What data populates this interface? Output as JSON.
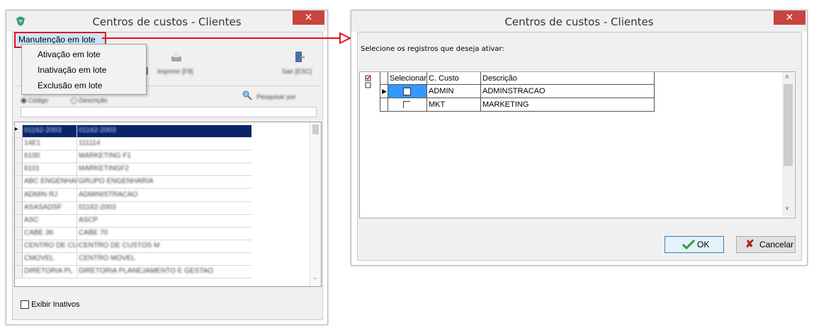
{
  "left_window": {
    "title": "Centros de custos - Clientes",
    "close": "✕",
    "menu": {
      "highlighted": "Manutenção em lote"
    },
    "dropdown": [
      "Ativação em lote",
      "Inativação em lote",
      "Exclusão em lote"
    ],
    "toolbar": {
      "partial_bracket": "]",
      "print_label": "Imprimir [F8]",
      "exit_label": "Sair [ESC]"
    },
    "search": {
      "radio_codigo": "Código",
      "radio_descricao": "Descrição",
      "search_button": "Pesquisar por"
    },
    "rows": [
      [
        "01162-2003",
        "01162-2003"
      ],
      [
        "14E1",
        "111114"
      ],
      [
        "6100",
        "MARKETING F1"
      ],
      [
        "6101",
        "MARKETINGF2"
      ],
      [
        "ABC ENGENHARIA",
        "GRUPO ENGENHARIA"
      ],
      [
        "ADMIN RJ",
        "ADMINISTRACAO"
      ],
      [
        "ASASADSF",
        "01162-2003"
      ],
      [
        "ASC",
        "ASCP"
      ],
      [
        "CABE 36",
        "CABE 70"
      ],
      [
        "CENTRO DE CUSTOS",
        "CENTRO DE CUSTOS M"
      ],
      [
        "CMOVEL",
        "CENTRO MOVEL"
      ],
      [
        "DIRETORIA PL",
        "DIRETORIA PLANEJAMENTO E GESTAO"
      ]
    ],
    "exibir_inativos": "Exibir Inativos"
  },
  "right_window": {
    "title": "Centros de custos - Clientes",
    "close": "✕",
    "instruction": "Selecione os registros que deseja ativar:",
    "columns": [
      "Selecionar",
      "C. Custo",
      "Descrição"
    ],
    "rows": [
      {
        "codigo": "ADMIN",
        "descricao": "ADMINSTRACAO"
      },
      {
        "codigo": "MKT",
        "descricao": "MARKETING"
      }
    ],
    "ok_label": "OK",
    "cancel_label": "Cancelar"
  },
  "colors": {
    "highlight_border": "#e0121a",
    "arrow": "#e0121a",
    "row_selected": "#0a246a",
    "close_button": "#c7453e"
  }
}
